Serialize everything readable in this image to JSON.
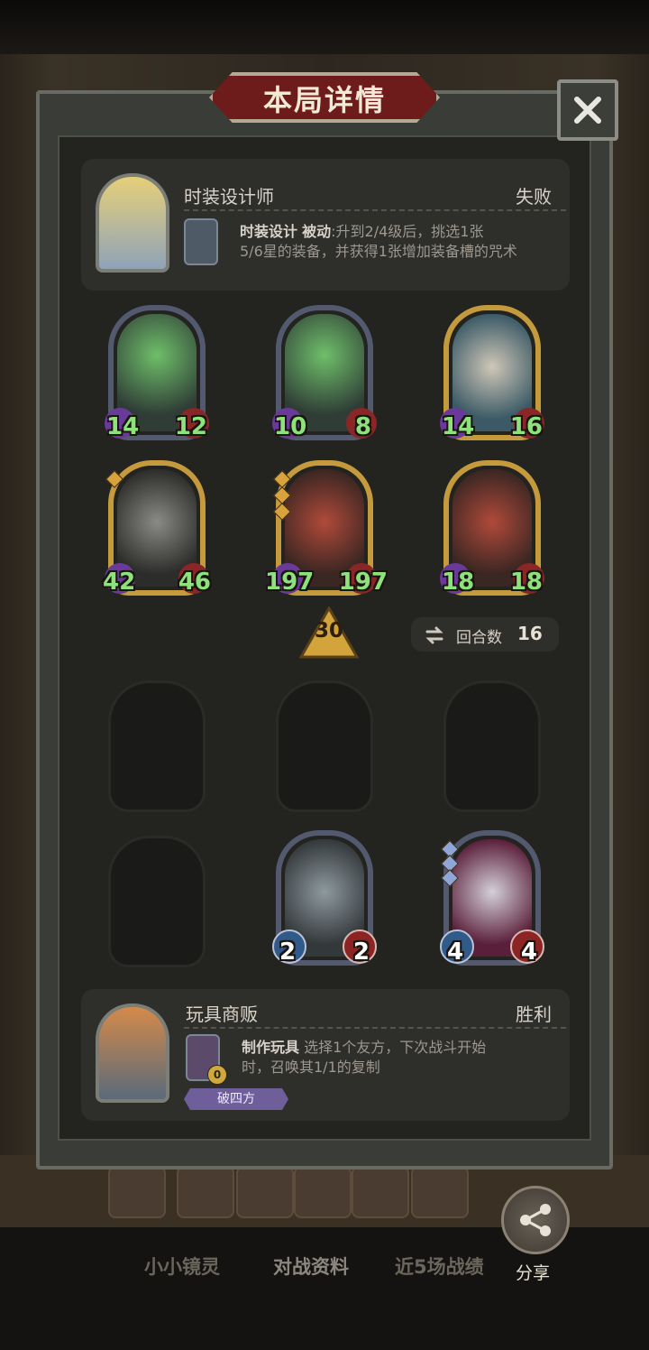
{
  "dialog": {
    "title": "本局详情"
  },
  "player_top": {
    "name": "时装设计师",
    "result": "失败",
    "skill_name": "时装设计",
    "skill_type": "被动",
    "skill_desc_1": ":升到2/4级后，挑选1张",
    "skill_desc_2": "5/6星的装备，并获得1张增加装备槽的咒术"
  },
  "cards_row1": [
    {
      "attack": "14",
      "health": "12",
      "stars": 0,
      "frame": "silver"
    },
    {
      "attack": "10",
      "health": "8",
      "stars": 0,
      "frame": "silver"
    },
    {
      "attack": "14",
      "health": "16",
      "stars": 0,
      "frame": "gold"
    }
  ],
  "cards_row2": [
    {
      "attack": "42",
      "health": "46",
      "stars": 1,
      "frame": "gold"
    },
    {
      "attack": "197",
      "health": "197",
      "stars": 3,
      "frame": "gold"
    },
    {
      "attack": "18",
      "health": "18",
      "stars": 0,
      "frame": "gold"
    }
  ],
  "level": "30",
  "rounds": {
    "label": "回合数",
    "value": "16"
  },
  "cards_bottom": [
    {
      "attack": "2",
      "health": "2",
      "stars": 0,
      "frame": "silver"
    },
    {
      "attack": "4",
      "health": "4",
      "stars": 3,
      "frame": "silver"
    }
  ],
  "player_bottom": {
    "name": "玩具商贩",
    "result": "胜利",
    "skill_name": "制作玩具",
    "skill_desc_1": "选择1个友方，下次战斗开始",
    "skill_desc_2": "时，召唤其1/1的复制",
    "gold_badge": "0",
    "tag": "破四方"
  },
  "bottom_nav": {
    "tabs": [
      "小小镜灵",
      "对战资料",
      "近5场战绩"
    ],
    "share": "分享"
  },
  "colors": {
    "panel": "#232320",
    "title_plate": "#6e1b1b",
    "stat_green": "#8ee27c"
  }
}
